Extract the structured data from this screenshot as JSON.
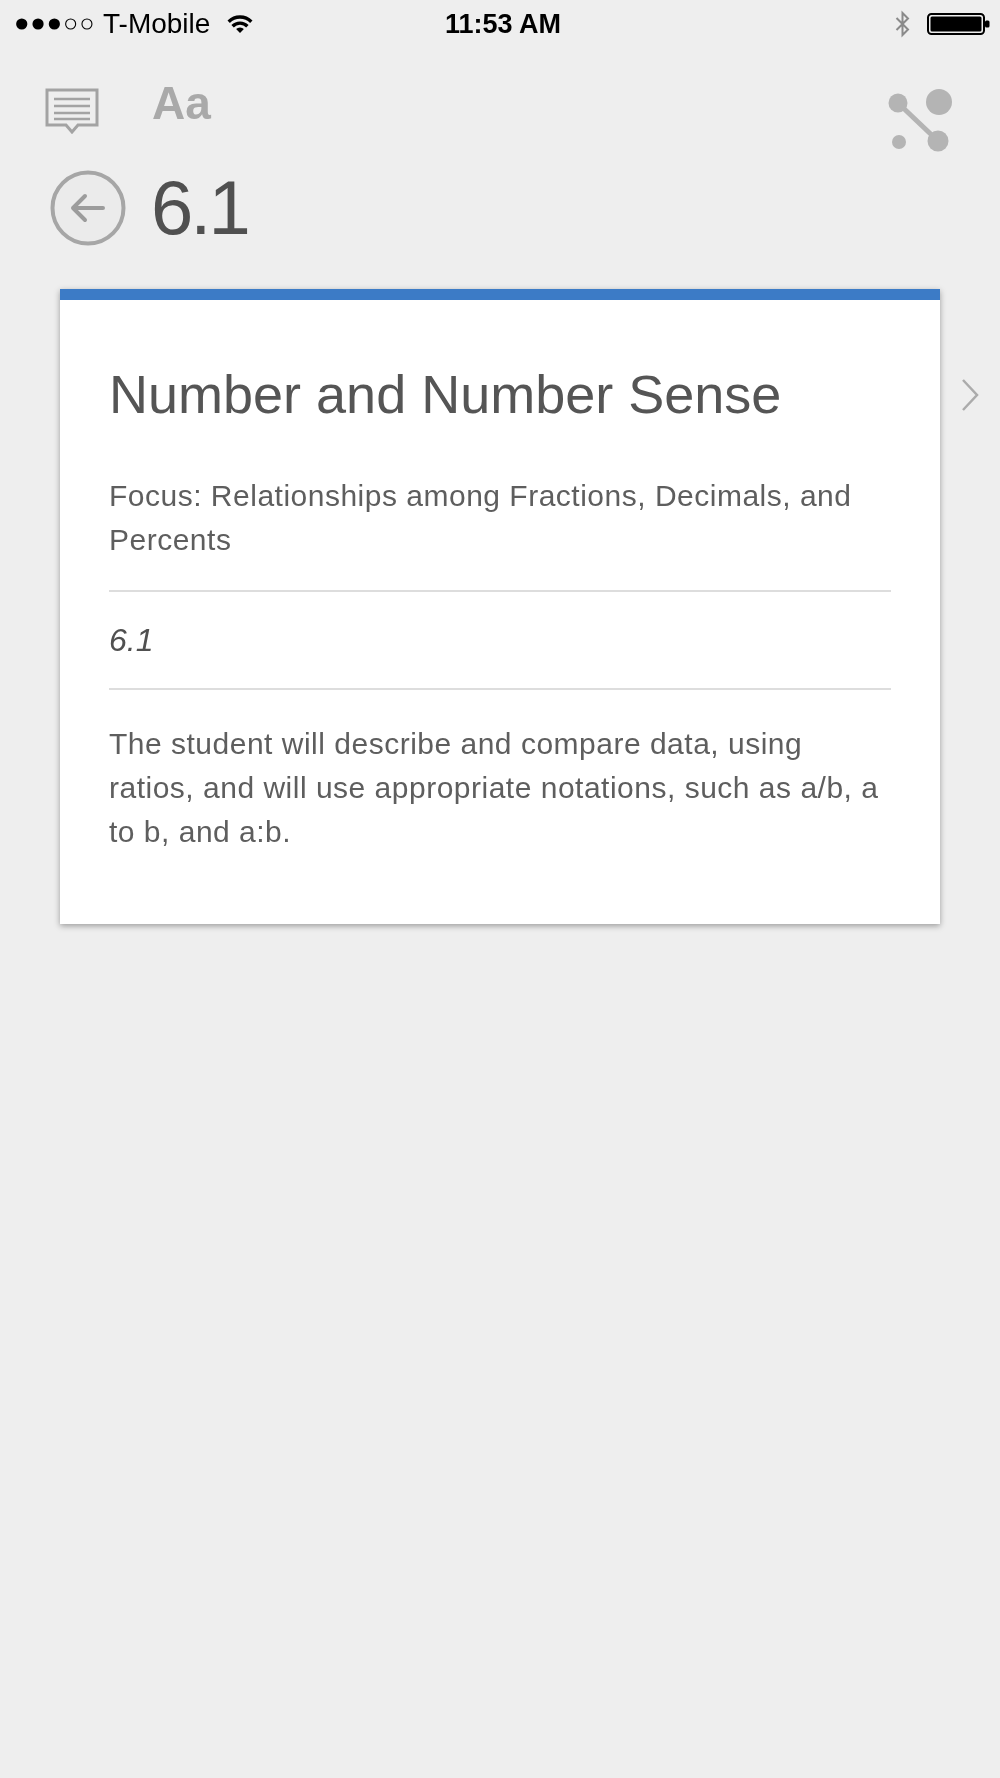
{
  "status_bar": {
    "carrier": "T-Mobile",
    "time": "11:53 AM"
  },
  "toolbar": {
    "font_size_button": "Aa"
  },
  "header": {
    "title": "6.1"
  },
  "card": {
    "title": "Number and Number Sense",
    "focus": "Focus: Relationships among Fractions, Decimals, and Percents",
    "code": "6.1",
    "description": "The student will describe and compare data, using ratios, and will use appropriate notations, such as a/b, a to b, and a:b."
  }
}
